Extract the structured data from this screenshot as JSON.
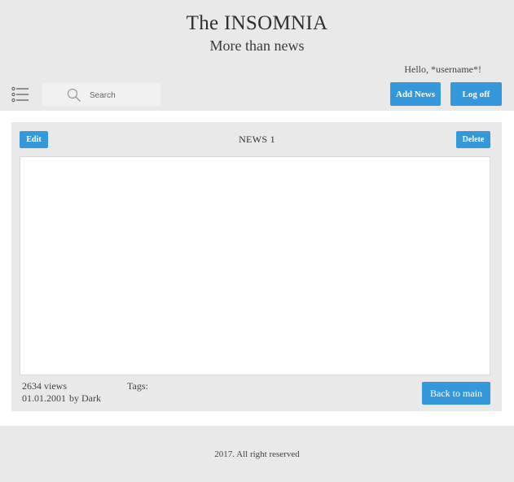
{
  "header": {
    "title": "The INSOMNIA",
    "subtitle": "More than news",
    "greeting": "Hello, *username*!",
    "menu_icon": "list-menu-icon",
    "search": {
      "placeholder": "Search",
      "value": "",
      "icon": "search-icon"
    },
    "add_news_label": "Add News",
    "log_off_label": "Log off"
  },
  "news": {
    "edit_label": "Edit",
    "title": "NEWS 1",
    "delete_label": "Delete",
    "views": "2634 views",
    "date": "01.01.2001",
    "author": "by Dark",
    "tags_label": "Tags:",
    "back_label": "Back to main"
  },
  "footer": {
    "copyright": "2017. All right reserved"
  },
  "colors": {
    "accent": "#3498db",
    "panel_bg": "#e9e9e9",
    "content_bg": "#ffffff"
  }
}
